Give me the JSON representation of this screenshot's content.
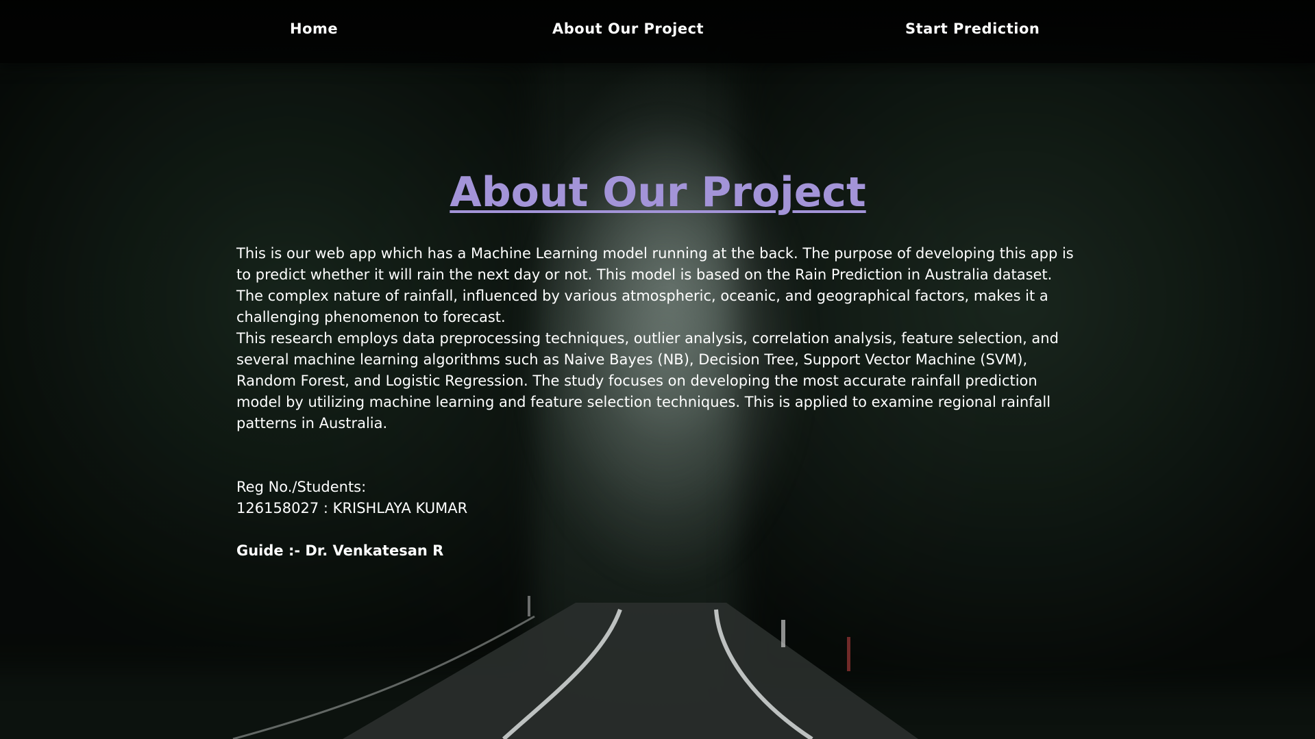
{
  "nav": {
    "home": "Home",
    "about": "About Our Project",
    "start": "Start Prediction"
  },
  "main": {
    "title": "About Our Project",
    "paragraph1": "This is our web app which has a Machine Learning model running at the back. The purpose of developing this app is to predict whether it will rain the next day or not. This model is based on the Rain Prediction in Australia dataset. The complex nature of rainfall, influenced by various atmospheric, oceanic, and geographical factors, makes it a challenging phenomenon to forecast.",
    "paragraph2": "This research employs data preprocessing techniques, outlier analysis, correlation analysis, feature selection, and several machine learning algorithms such as Naive Bayes (NB), Decision Tree, Support Vector Machine (SVM), Random Forest, and Logistic Regression. The study focuses on developing the most accurate rainfall prediction model by utilizing machine learning and feature selection techniques. This is applied to examine regional rainfall patterns in Australia.",
    "students_label": "Reg No./Students:",
    "student_entry": "126158027 : KRISHLAYA KUMAR",
    "guide": "Guide :- Dr. Venkatesan R"
  },
  "colors": {
    "title": "#a394d8",
    "text": "#ffffff",
    "navbar": "#000000"
  }
}
